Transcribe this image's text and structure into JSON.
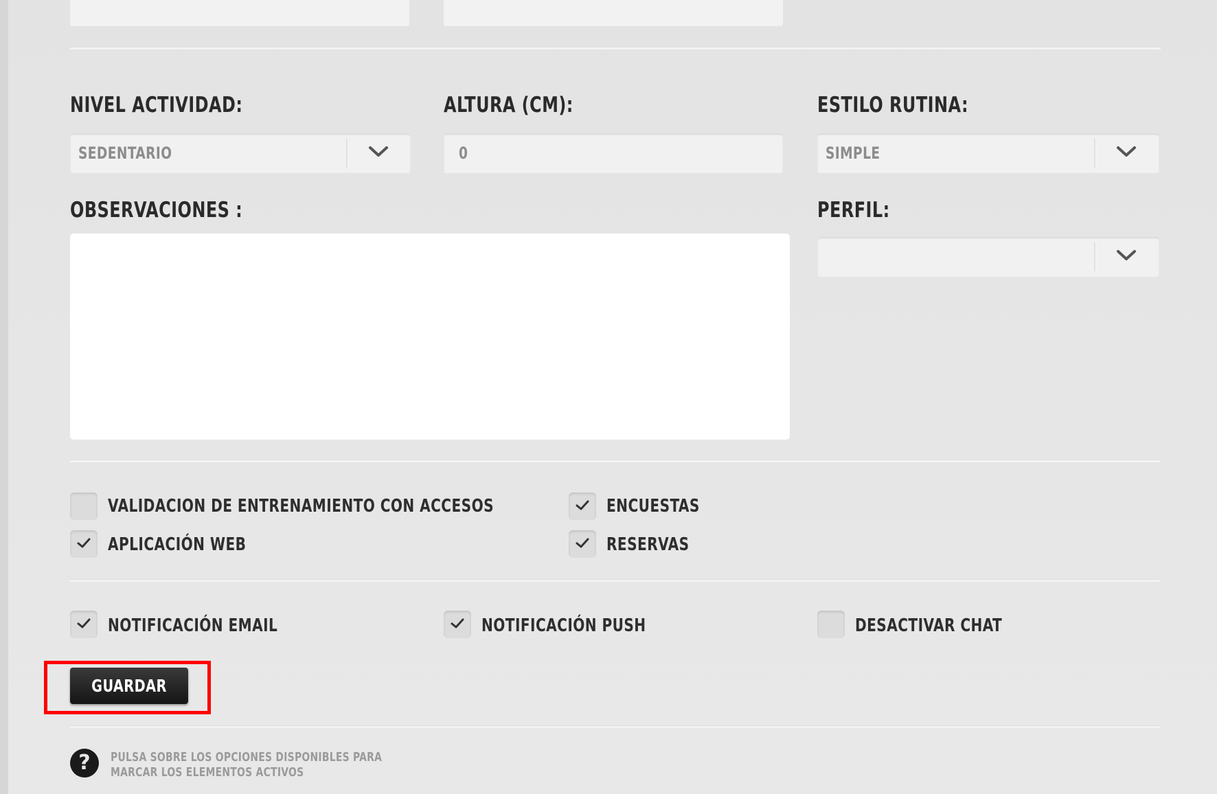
{
  "form": {
    "nivel_actividad": {
      "label": "NIVEL ACTIVIDAD:",
      "value": "SEDENTARIO"
    },
    "altura": {
      "label": "ALTURA (CM):",
      "value": "0"
    },
    "estilo_rutina": {
      "label": "ESTILO RUTINA:",
      "value": "SIMPLE"
    },
    "observaciones": {
      "label": "OBSERVACIONES :",
      "value": ""
    },
    "perfil": {
      "label": "PERFIL:",
      "value": ""
    }
  },
  "options": [
    {
      "label": "VALIDACION DE ENTRENAMIENTO CON ACCESOS",
      "checked": false
    },
    {
      "label": "ENCUESTAS",
      "checked": true
    },
    {
      "label": "APLICACIÓN WEB",
      "checked": true
    },
    {
      "label": "RESERVAS",
      "checked": true
    }
  ],
  "notifications": [
    {
      "label": "NOTIFICACIÓN EMAIL",
      "checked": true
    },
    {
      "label": "NOTIFICACIÓN PUSH",
      "checked": true
    },
    {
      "label": "DESACTIVAR CHAT",
      "checked": false
    }
  ],
  "save_label": "GUARDAR",
  "help": {
    "icon": "question-circle-icon",
    "line1": "PULSA SOBRE LOS OPCIONES DISPONIBLES PARA",
    "line2": "MARCAR LOS ELEMENTOS ACTIVOS"
  },
  "colors": {
    "highlight": "#ff0000",
    "button": "#1f1f1f",
    "background": "#e5e5e5"
  }
}
